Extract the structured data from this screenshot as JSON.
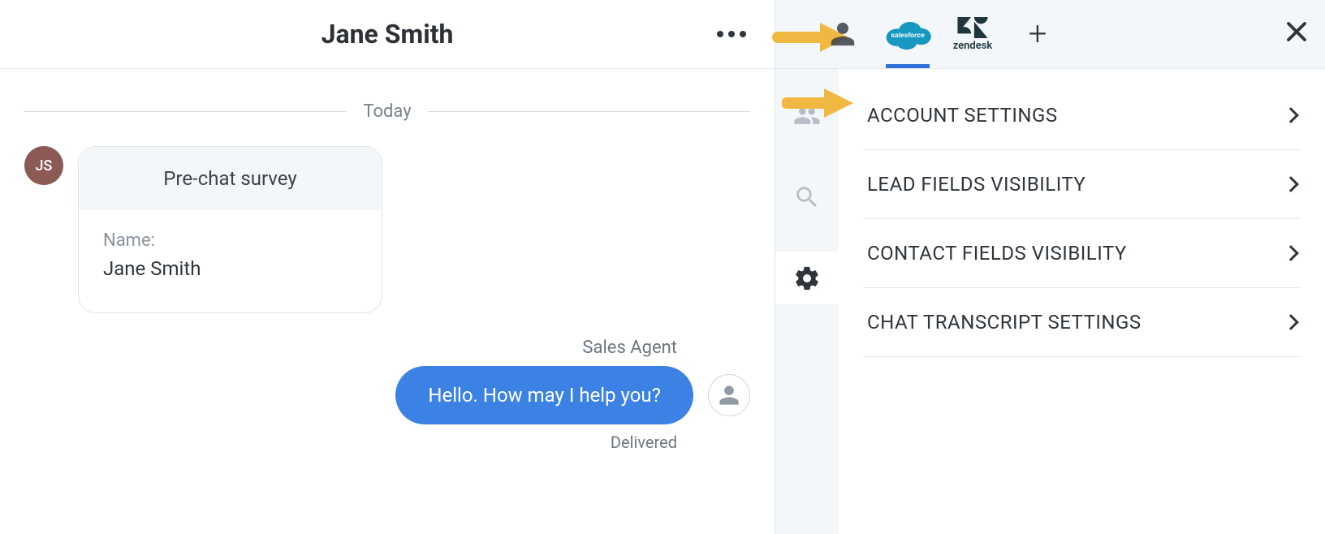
{
  "chat": {
    "contact_name": "Jane Smith",
    "avatar_initials": "JS",
    "date_separator": "Today",
    "survey": {
      "title": "Pre-chat survey",
      "name_label": "Name:",
      "name_value": "Jane Smith"
    },
    "agent": {
      "name": "Sales Agent",
      "message": "Hello. How may I help you?",
      "status": "Delivered"
    }
  },
  "side": {
    "apps": {
      "salesforce_label": "salesforce",
      "zendesk_label": "zendesk"
    },
    "settings": [
      {
        "label": "ACCOUNT SETTINGS"
      },
      {
        "label": "LEAD FIELDS VISIBILITY"
      },
      {
        "label": "CONTACT FIELDS VISIBILITY"
      },
      {
        "label": "CHAT TRANSCRIPT SETTINGS"
      }
    ]
  }
}
